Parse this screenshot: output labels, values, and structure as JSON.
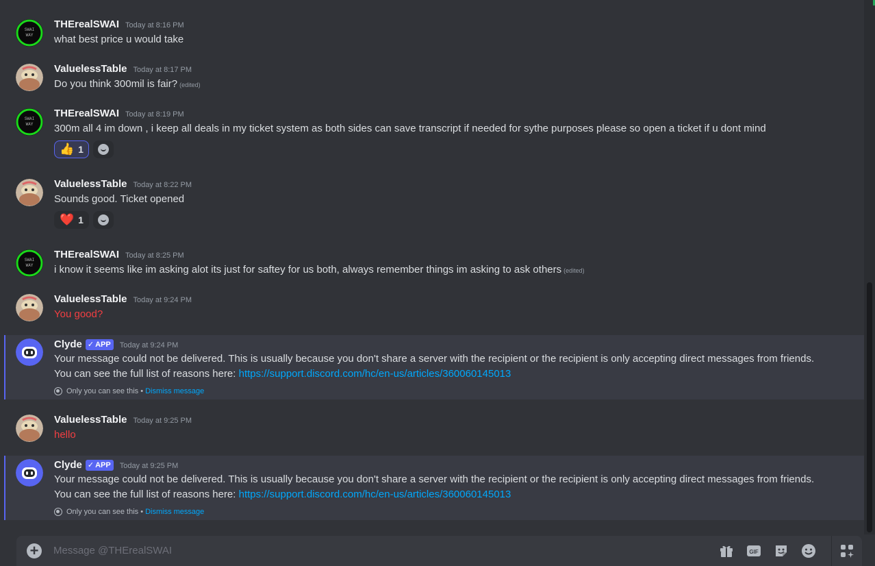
{
  "messages": [
    {
      "author": "THErealSWAI",
      "time": "Today at 8:16 PM",
      "text": "what best price u would take",
      "avatar": "swai"
    },
    {
      "author": "ValuelessTable",
      "time": "Today at 8:17 PM",
      "text": "Do you think 300mil is fair?",
      "edited": "(edited)",
      "avatar": "table"
    },
    {
      "author": "THErealSWAI",
      "time": "Today at 8:19 PM",
      "text": "300m all 4 im down , i keep all deals in my ticket system as both sides can save transcript if needed for sythe purposes please  so open a ticket if u dont mind",
      "avatar": "swai",
      "reaction": {
        "emoji": "👍",
        "count": "1",
        "active": true
      }
    },
    {
      "author": "ValuelessTable",
      "time": "Today at 8:22 PM",
      "text": "Sounds good. Ticket opened",
      "avatar": "table",
      "reaction": {
        "emoji": "❤️",
        "count": "1",
        "active": false
      }
    },
    {
      "author": "THErealSWAI",
      "time": "Today at 8:25 PM",
      "text": "i know it seems like im asking alot its just for saftey for us both, always  remember things im asking to ask others",
      "edited": "(edited)",
      "avatar": "swai"
    },
    {
      "author": "ValuelessTable",
      "time": "Today at 9:24 PM",
      "text": "You good?",
      "avatar": "table",
      "failed": true
    },
    {
      "author": "Clyde",
      "badge": "APP",
      "time": "Today at 9:24 PM",
      "line1": "Your message could not be delivered. This is usually because you don't share a server with the recipient or the recipient is only accepting direct messages from friends.",
      "line2_prefix": "You can see the full list of reasons here: ",
      "link": "https://support.discord.com/hc/en-us/articles/360060145013",
      "only_you": "Only you can see this •",
      "dismiss": "Dismiss message",
      "avatar": "clyde"
    },
    {
      "author": "ValuelessTable",
      "time": "Today at 9:25 PM",
      "text": "hello",
      "avatar": "table",
      "failed": true
    },
    {
      "author": "Clyde",
      "badge": "APP",
      "time": "Today at 9:25 PM",
      "line1": "Your message could not be delivered. This is usually because you don't share a server with the recipient or the recipient is only accepting direct messages from friends.",
      "line2_prefix": "You can see the full list of reasons here: ",
      "link": "https://support.discord.com/hc/en-us/articles/360060145013",
      "only_you": "Only you can see this •",
      "dismiss": "Dismiss message",
      "avatar": "clyde"
    }
  ],
  "composer": {
    "placeholder": "Message @THErealSWAI",
    "gif_label": "GIF"
  },
  "colors": {
    "accent": "#5865f2",
    "link": "#00a8fc",
    "failed": "#f23f42",
    "background": "#313338"
  }
}
